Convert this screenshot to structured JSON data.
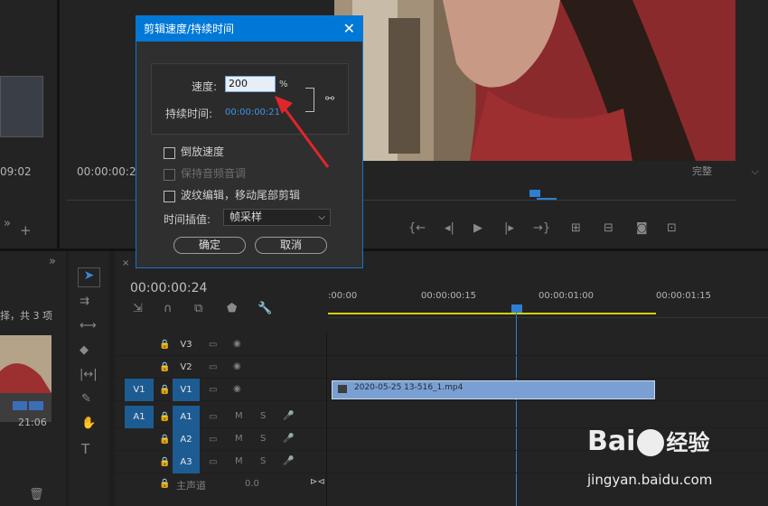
{
  "dialog": {
    "title": "剪辑速度/持续时间",
    "close_glyph": "✕",
    "speed_label": "速度:",
    "speed_value": "200",
    "speed_unit": "%",
    "duration_label": "持续时间:",
    "duration_value": "00:00:00:21",
    "reverse_label": "倒放速度",
    "keep_pitch_label": "保持音频音调",
    "ripple_label": "波纹编辑，移动尾部剪辑",
    "interp_label": "时间插值:",
    "interp_value": "帧采样",
    "ok_label": "确定",
    "cancel_label": "取消"
  },
  "program_monitor": {
    "timecode": "00:00:00:2",
    "fit_value": "完整"
  },
  "source_panel": {
    "timecode": "09:02"
  },
  "project_panel": {
    "info_text": "择，共 3 项",
    "clip_duration": "21:06"
  },
  "timeline": {
    "timecode": "00:00:00:24",
    "ruler_labels": [
      ":00:00",
      "00:00:00:15",
      "00:00:01:00",
      "00:00:01:15"
    ],
    "clip_name": "2020-05-25 13-516_1.mp4",
    "video_tracks": [
      {
        "name": "V3",
        "source": ""
      },
      {
        "name": "V2",
        "source": ""
      },
      {
        "name": "V1",
        "source": "V1"
      }
    ],
    "audio_tracks": [
      {
        "name": "A1",
        "source": "A1"
      },
      {
        "name": "A2",
        "source": ""
      },
      {
        "name": "A3",
        "source": ""
      }
    ],
    "master_label": "主声道",
    "master_value": "0.0",
    "m_label": "M",
    "s_label": "S"
  },
  "watermark": {
    "brand": "Bai",
    "brand2": "经验",
    "url": "jingyan.baidu.com"
  },
  "colors": {
    "accent": "#0078d7",
    "track_blue": "#1d5c92",
    "clip_blue": "#7a9fd2",
    "arrow_red": "#e0262b",
    "work_area_yellow": "#d4d000"
  }
}
